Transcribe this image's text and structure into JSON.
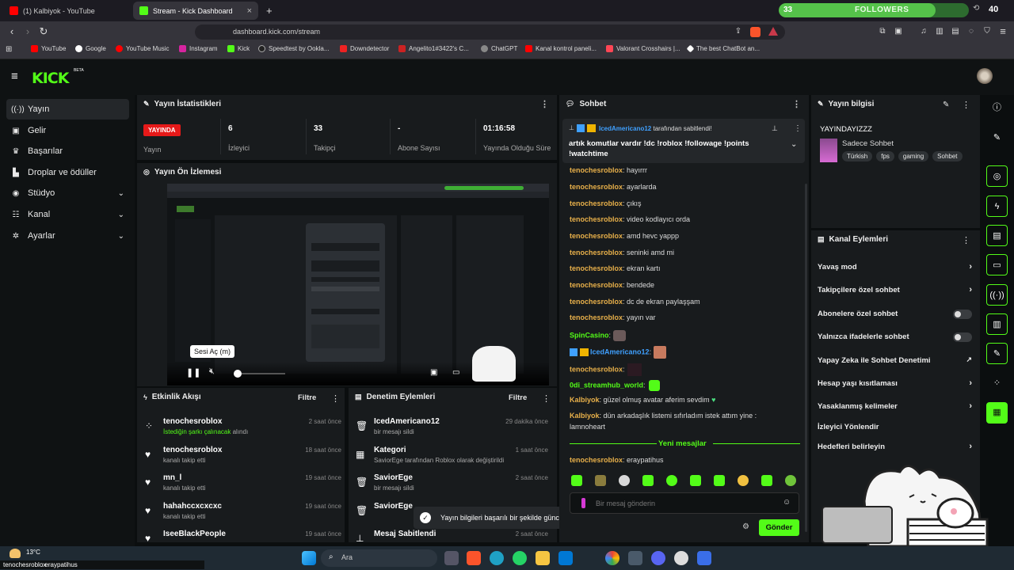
{
  "browser": {
    "tabs": [
      {
        "label": "(1) Kalbiyok - YouTube",
        "active": false
      },
      {
        "label": "Stream - Kick Dashboard",
        "active": true
      }
    ],
    "new_tab": "+",
    "url": "dashboard.kick.com/stream",
    "bookmarks": [
      "YouTube",
      "Google",
      "YouTube Music",
      "Instagram",
      "Kick",
      "Speedtest by Ookla...",
      "Downdetector",
      "Angelito1#3422's C...",
      "ChatGPT",
      "Kanal kontrol paneli...",
      "Valorant Crosshairs |...",
      "The best ChatBot an..."
    ],
    "followers_widget": {
      "current": "33",
      "label": "FOLLOWERS",
      "goal": "40",
      "progress": 0.825
    }
  },
  "header": {
    "logo": "KICK",
    "beta": "BETA"
  },
  "sidebar": {
    "items": [
      {
        "label": "Yayın",
        "icon": "broadcast-icon",
        "active": true
      },
      {
        "label": "Gelir",
        "icon": "wallet-icon"
      },
      {
        "label": "Başarılar",
        "icon": "trophy-icon"
      },
      {
        "label": "Droplar ve ödüller",
        "icon": "gift-icon"
      },
      {
        "label": "Stüdyo",
        "icon": "studio-icon",
        "expand": true
      },
      {
        "label": "Kanal",
        "icon": "channel-icon",
        "expand": true
      },
      {
        "label": "Ayarlar",
        "icon": "settings-icon",
        "expand": true
      }
    ]
  },
  "stats": {
    "title": "Yayın İstatistikleri",
    "live_badge": "YAYINDA",
    "live_label": "Yayın",
    "items": [
      {
        "value": "6",
        "label": "İzleyici"
      },
      {
        "value": "33",
        "label": "Takipçi"
      },
      {
        "value": "-",
        "label": "Abone Sayısı"
      },
      {
        "value": "01:16:58",
        "label": "Yayında Olduğu Süre"
      }
    ]
  },
  "preview": {
    "title": "Yayın Ön İzlemesi",
    "tooltip": "Sesi Aç (m)"
  },
  "events": {
    "title": "Etkinlik Akışı",
    "filter": "Filtre",
    "rows": [
      {
        "name": "tenochesroblox",
        "time": "2 saat önce",
        "hl": "İstediğin şarkı çalınacak",
        "rest": " alındı",
        "icon": "redeem-icon"
      },
      {
        "name": "tenochesroblox",
        "time": "18 saat önce",
        "hl": "",
        "rest": "kanalı takip etti",
        "icon": "heart-icon"
      },
      {
        "name": "mn_l",
        "time": "19 saat önce",
        "hl": "",
        "rest": "kanalı takip etti",
        "icon": "heart-icon"
      },
      {
        "name": "hahahccxcxcxc",
        "time": "19 saat önce",
        "hl": "",
        "rest": "kanalı takip etti",
        "icon": "heart-icon"
      },
      {
        "name": "IseeBlackPeople",
        "time": "19 saat önce",
        "hl": "",
        "rest": "",
        "icon": "heart-icon"
      }
    ]
  },
  "moderation": {
    "title": "Denetim Eylemleri",
    "filter": "Filtre",
    "rows": [
      {
        "name": "IcedAmericano12",
        "time": "29 dakika önce",
        "d1": "bir mesajı sildi",
        "icon": "trash-icon"
      },
      {
        "name": "Kategori",
        "time": "1 saat önce",
        "d1": "SaviorEge tarafından Roblox olarak değiştirildi",
        "icon": "category-icon"
      },
      {
        "name": "SaviorEge",
        "time": "2 saat önce",
        "d1": "bir mesajı sildi",
        "icon": "trash-icon"
      },
      {
        "name": "SaviorEge",
        "time": "",
        "d1": "",
        "icon": "trash-icon"
      },
      {
        "name": "Mesaj Sabitlendi",
        "time": "2 saat önce",
        "d1": "",
        "icon": "pin-icon"
      }
    ]
  },
  "toast": "Yayın bilgileri başarılı bir şekilde güncellendi.",
  "chat": {
    "title": "Sohbet",
    "pinned_by": "IcedAmericano12",
    "pinned_suffix": " tarafından sabitlendi!",
    "pinned_text": "artık komutlar vardır !dc !roblox !followage !points !watchtime",
    "messages": [
      {
        "user": "tenochesroblox",
        "text": ": hayırrr"
      },
      {
        "user": "tenochesroblox",
        "text": ": ayarlarda"
      },
      {
        "user": "tenochesroblox",
        "text": ": çıkış"
      },
      {
        "user": "tenochesroblox",
        "text": ": video kodlayıcı orda"
      },
      {
        "user": "tenochesroblox",
        "text": ": amd hevc yappp"
      },
      {
        "user": "tenochesroblox",
        "text": ": seninki amd mi"
      },
      {
        "user": "tenochesroblox",
        "text": ": ekran kartı"
      },
      {
        "user": "tenochesroblox",
        "text": ": bendede"
      },
      {
        "user": "tenochesroblox",
        "text": ": dc de ekran paylaşşam"
      },
      {
        "user": "tenochesroblox",
        "text": ": yayın var"
      },
      {
        "user": "SpinCasino",
        "text": ":"
      },
      {
        "user": "IcedAmericano12",
        "text": ":"
      },
      {
        "user": "tenochesroblox",
        "text": ":"
      },
      {
        "user": "0di_streamhub_world",
        "text": ":"
      },
      {
        "user": "Kalbiyok",
        "text": ": güzel olmuş avatar aferim sevdim"
      },
      {
        "user": "Kalbiyok",
        "text": ": dün arkadaşlık listemi sıfırladım istek attım yine :"
      },
      {
        "user": "",
        "text": "lamnoheart"
      }
    ],
    "new_messages": "Yeni mesajlar",
    "last": {
      "user": "tenochesroblox",
      "text": ": eraypatihus"
    },
    "input_placeholder": "Bir mesaj gönderin",
    "send": "Gönder"
  },
  "stream_info": {
    "title": "Yayın bilgisi",
    "stream_title": "YAYINDAYIZZZ",
    "category": "Sadece Sohbet",
    "tags": [
      "Türkish",
      "fps",
      "gaming",
      "Sohbet"
    ]
  },
  "channel_actions": {
    "title": "Kanal Eylemleri",
    "items": [
      {
        "label": "Yavaş mod",
        "type": "chevron"
      },
      {
        "label": "Takipçilere özel sohbet",
        "type": "chevron"
      },
      {
        "label": "Abonelere özel sohbet",
        "type": "toggle"
      },
      {
        "label": "Yalnızca ifadelerle sohbet",
        "type": "toggle"
      },
      {
        "label": "Yapay Zeka ile Sohbet Denetimi",
        "type": "external"
      },
      {
        "label": "Hesap yaşı kısıtlaması",
        "type": "chevron"
      },
      {
        "label": "Yasaklanmış kelimeler",
        "type": "chevron"
      },
      {
        "label": "İzleyici Yönlendir",
        "type": "none"
      },
      {
        "label": "Hedefleri belirleyin",
        "type": "chevron"
      }
    ]
  },
  "taskbar": {
    "temp": "13°C",
    "weather": "Bulutlu",
    "search": "Ara",
    "overlay_user": "tenochesroblox",
    "overlay_text": ": eraypatihus"
  },
  "colors": {
    "accent": "#53fc18",
    "live": "#e61919",
    "panel": "#181b1d",
    "bg": "#0b0e0f"
  }
}
